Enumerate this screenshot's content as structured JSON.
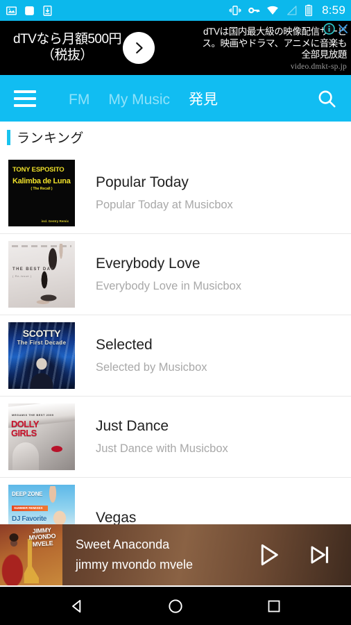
{
  "status_bar": {
    "time": "8:59",
    "background": "#0cb8ec",
    "left_icons": [
      "image-icon",
      "note-icon",
      "download-icon"
    ],
    "right_icons": [
      "vibrate-icon",
      "vpn-key-icon",
      "wifi-alert-icon",
      "signal-icon",
      "battery-icon"
    ]
  },
  "ad": {
    "headline_line1": "dTVなら月額500円",
    "headline_line2": "（税抜）",
    "body_line1": "dTVは国内最大級の映像配信サービ",
    "body_line2": "ス。映画やドラマ、アニメに音楽も",
    "body_line3": "全部見放題",
    "url": "video.dmkt-sp.jp",
    "arrow_icon": "chevron-right-icon",
    "info_icon": "adchoices-info-icon",
    "close_icon": "close-icon",
    "background": "#000000"
  },
  "app_bar": {
    "background": "#11bdf2",
    "menu_icon": "hamburger-menu-icon",
    "search_icon": "search-icon",
    "tabs": [
      {
        "label": "FM",
        "active": false
      },
      {
        "label": "My Music",
        "active": false
      },
      {
        "label": "発見",
        "active": true
      }
    ],
    "inactive_color": "#8fe2fa",
    "active_color": "#ffffff"
  },
  "section": {
    "title": "ランキング",
    "accent_color": "#18c3ee"
  },
  "list": {
    "items": [
      {
        "title": "Popular Today",
        "subtitle": "Popular Today at Musicbox",
        "art_name": "album-art-kalimba-de-luna",
        "art_text": {
          "line1": "TONY ESPOSITO",
          "line2": "Kalimba de Luna",
          "line3": "( The Recall )",
          "line4": "incl. Gentry Remix"
        }
      },
      {
        "title": "Everybody Love",
        "subtitle": "Everybody Love in Musicbox",
        "art_name": "album-art-the-best-day",
        "art_text": {
          "line1": "THE BEST DAY",
          "line2": "( Re-issue )"
        }
      },
      {
        "title": "Selected",
        "subtitle": "Selected by Musicbox",
        "art_name": "album-art-scotty-first-decade",
        "art_text": {
          "line1": "SCOTTY",
          "line2": "The First Decade"
        }
      },
      {
        "title": "Just Dance",
        "subtitle": "Just Dance with Musicbox",
        "art_name": "album-art-dolly-girls",
        "art_text": {
          "line0": "MEGAMIX THE BEST 2009",
          "line1": "DOLLY",
          "line2": "GIRLS"
        }
      },
      {
        "title": "Vegas",
        "subtitle": "",
        "art_name": "album-art-deep-zone",
        "art_text": {
          "line1": "DEEP ZONE",
          "line2": "DJ Favorite",
          "bar": "SUMMER REMIXES"
        }
      }
    ]
  },
  "player": {
    "track_title": "Sweet Anaconda",
    "artist": "jimmy mvondo mvele",
    "art_name": "now-playing-art-jimmy-mvondo-mvele",
    "art_text": "JIMMY MVONDO MVELE",
    "play_icon": "play-icon",
    "next_icon": "skip-next-icon"
  },
  "android_nav": {
    "back_icon": "back-triangle-icon",
    "home_icon": "home-circle-icon",
    "recents_icon": "recents-square-icon"
  }
}
